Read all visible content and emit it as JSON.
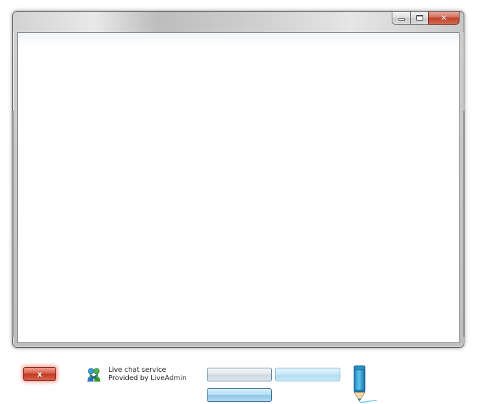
{
  "window": {
    "caption_buttons": {
      "minimize_icon": "minimize-icon",
      "maximize_icon": "maximize-icon",
      "close_icon": "close-icon"
    },
    "title_text": "",
    "content_text": ""
  },
  "footer": {
    "close_button_label": "x",
    "credit_line1": "Live chat service",
    "credit_line2": "Provided by LiveAdmin",
    "logo_icon": "liveadmin-logo-icon",
    "buttons": [
      {
        "label": ""
      },
      {
        "label": ""
      },
      {
        "label": ""
      }
    ],
    "pen_icon": "pen-icon"
  },
  "colors": {
    "close_red": "#c03a22",
    "button_blue": "#8fc8ea",
    "frame_gray": "#bdbdbd",
    "client_bg": "#ffffff"
  }
}
